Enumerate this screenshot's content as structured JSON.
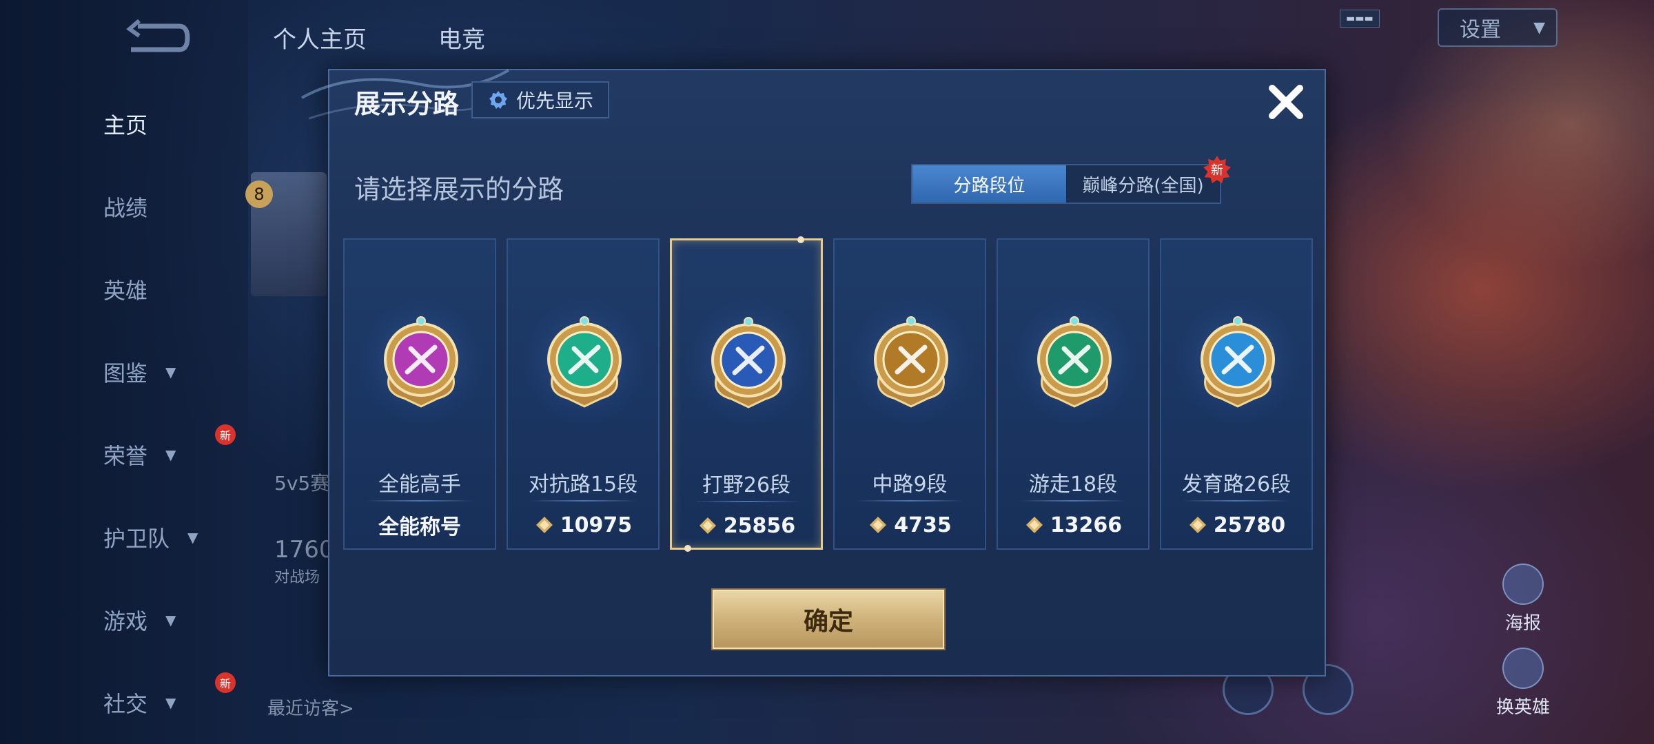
{
  "background": {
    "nav_items": [
      {
        "label": "主页",
        "chevron": false,
        "badge": ""
      },
      {
        "label": "战绩",
        "chevron": false,
        "badge": ""
      },
      {
        "label": "英雄",
        "chevron": false,
        "badge": ""
      },
      {
        "label": "图鉴",
        "chevron": true,
        "badge": ""
      },
      {
        "label": "荣誉",
        "chevron": true,
        "badge": "新"
      },
      {
        "label": "护卫队",
        "chevron": true,
        "badge": ""
      },
      {
        "label": "游戏",
        "chevron": true,
        "badge": ""
      },
      {
        "label": "社交",
        "chevron": true,
        "badge": "新"
      }
    ],
    "top_tabs": [
      "个人主页",
      "电竞"
    ],
    "settings_label": "设置",
    "rank_level": "8",
    "mode_text": "5v5赛",
    "count_text": "1760",
    "battle_text": "对战场",
    "visitors_text": "最近访客>",
    "poster_label": "海报",
    "swap_hero_label": "换英雄"
  },
  "modal": {
    "title": "展示分路",
    "priority_label": "优先显示",
    "subtitle": "请选择展示的分路",
    "segments": [
      {
        "label": "分路段位",
        "active": true
      },
      {
        "label": "巅峰分路(全国)",
        "active": false,
        "badge": "新"
      }
    ],
    "lanes": [
      {
        "name": "全能高手",
        "value": "全能称号",
        "has_icon": false,
        "selected": false,
        "color": "#b13bb5"
      },
      {
        "name": "对抗路15段",
        "value": "10975",
        "has_icon": true,
        "selected": false,
        "color": "#1fae8a"
      },
      {
        "name": "打野26段",
        "value": "25856",
        "has_icon": true,
        "selected": true,
        "color": "#2a5ab8"
      },
      {
        "name": "中路9段",
        "value": "4735",
        "has_icon": true,
        "selected": false,
        "color": "#b07a26"
      },
      {
        "name": "游走18段",
        "value": "13266",
        "has_icon": true,
        "selected": false,
        "color": "#1f9a6a"
      },
      {
        "name": "发育路26段",
        "value": "25780",
        "has_icon": true,
        "selected": false,
        "color": "#2a8fd8"
      }
    ],
    "confirm_label": "确定"
  }
}
